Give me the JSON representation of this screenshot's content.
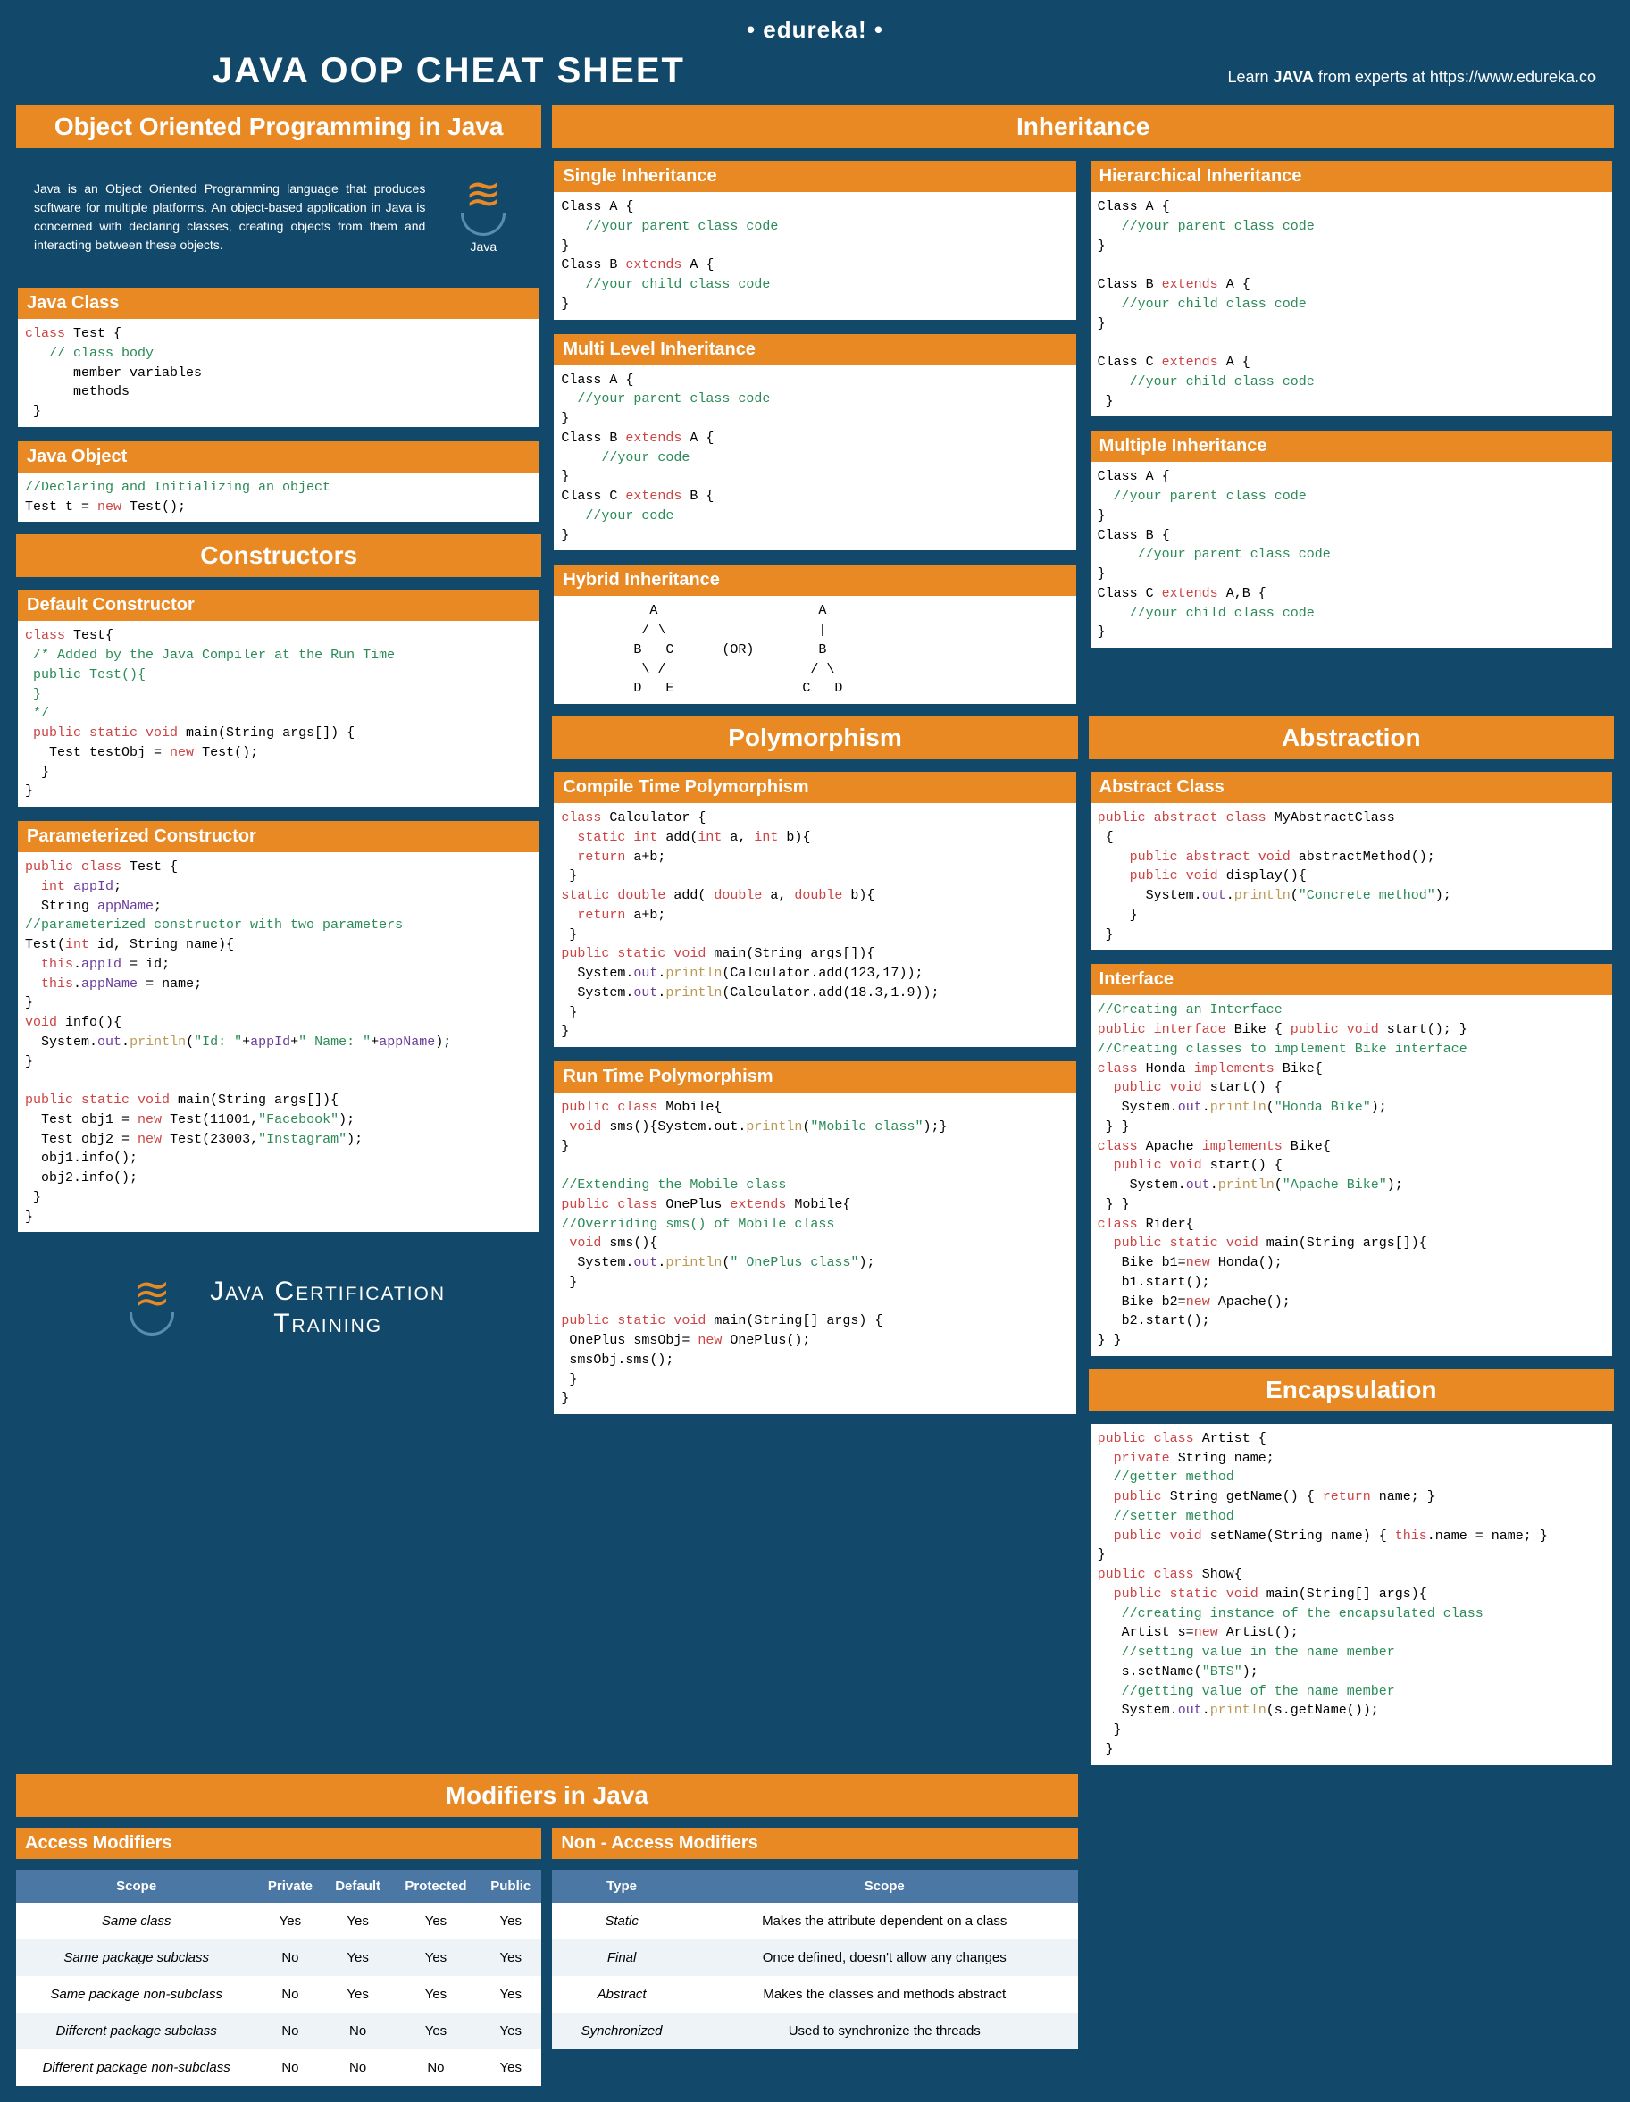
{
  "brand": "• edureka! •",
  "title": "JAVA OOP CHEAT SHEET",
  "learn_prefix": "Learn ",
  "learn_bold": "JAVA",
  "learn_mid": " from experts at ",
  "learn_url": "https://www.edureka.co",
  "s_oop": "Object Oriented Programming in Java",
  "intro": "Java is an Object Oriented Programming language that produces software for multiple platforms. An object-based application in Java is concerned with declaring classes, creating objects from them and interacting between these objects.",
  "java_logo_label": "Java",
  "h_class": "Java Class",
  "h_object": "Java Object",
  "s_constructors": "Constructors",
  "h_defcon": "Default Constructor",
  "h_paramcon": "Parameterized Constructor",
  "cert_line1": "Java Certification",
  "cert_line2": "Training",
  "s_inherit": "Inheritance",
  "h_single": "Single Inheritance",
  "h_multi": "Multi Level Inheritance",
  "h_hybrid": "Hybrid Inheritance",
  "h_hier": "Hierarchical Inheritance",
  "h_multiple": "Multiple Inheritance",
  "s_poly": "Polymorphism",
  "h_ctp": "Compile Time Polymorphism",
  "h_rtp": "Run Time Polymorphism",
  "s_abs": "Abstraction",
  "h_absclass": "Abstract Class",
  "h_iface": "Interface",
  "s_enc": "Encapsulation",
  "s_mod": "Modifiers in Java",
  "h_access": "Access Modifiers",
  "h_nonaccess": "Non - Access Modifiers",
  "access_headers": [
    "Scope",
    "Private",
    "Default",
    "Protected",
    "Public"
  ],
  "access_rows": [
    [
      "Same class",
      "Yes",
      "Yes",
      "Yes",
      "Yes"
    ],
    [
      "Same package subclass",
      "No",
      "Yes",
      "Yes",
      "Yes"
    ],
    [
      "Same package non-subclass",
      "No",
      "Yes",
      "Yes",
      "Yes"
    ],
    [
      "Different package subclass",
      "No",
      "No",
      "Yes",
      "Yes"
    ],
    [
      "Different package non-subclass",
      "No",
      "No",
      "No",
      "Yes"
    ]
  ],
  "nonaccess_headers": [
    "Type",
    "Scope"
  ],
  "nonaccess_rows": [
    [
      "Static",
      "Makes the attribute dependent on a class"
    ],
    [
      "Final",
      "Once defined, doesn't allow any changes"
    ],
    [
      "Abstract",
      "Makes the classes and methods abstract"
    ],
    [
      "Synchronized",
      "Used to synchronize the threads"
    ]
  ]
}
